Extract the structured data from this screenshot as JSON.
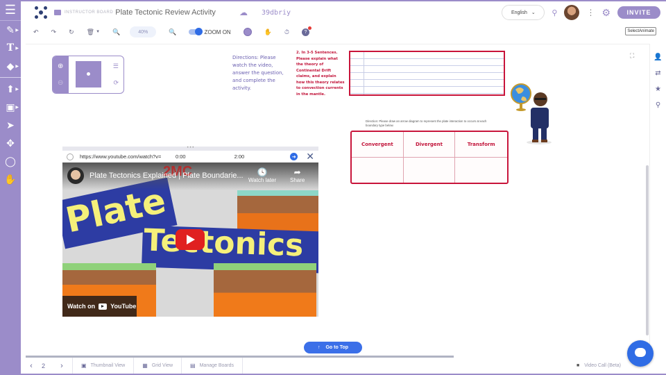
{
  "header": {
    "board_kind": "INSTRUCTOR BOARD",
    "board_title": "Plate Tectonic Review Activity",
    "board_code": "39dbriy",
    "language": "English",
    "invite_label": "INVITE"
  },
  "left_toolbar": {
    "items": [
      "menu",
      "pen",
      "text",
      "eraser",
      "upload",
      "toolbox",
      "pointer",
      "move",
      "lasso",
      "hand"
    ]
  },
  "toolbar": {
    "zoom_level": "40%",
    "zoom_toggle_label": "ZOOM ON",
    "select_animate_label": "SelectAnimate"
  },
  "canvas": {
    "directions": "Directions: Please watch the video, answer the question, and complete the activity.",
    "question": "2. In 3-5 Sentences. Please explain what the theory of Continental Drift claims, and explain how this theory relates to convection currents in the mantle.",
    "diagram_direction": "Direction: Please draw an arrow diagram to represent the plate interaction to occurs at each boundary type below.",
    "boundary_table": {
      "headers": [
        "Convergent",
        "Divergent",
        "Transform"
      ],
      "rows": [
        [
          "",
          "",
          ""
        ]
      ]
    }
  },
  "video": {
    "url": "https://www.youtube.com/watch?v=",
    "start_time": "0:00",
    "end_time": "2:00",
    "title": "Plate Tectonics Explained | Plate Boundarie...",
    "channel_logo_text": "2MC",
    "watch_later_label": "Watch later",
    "share_label": "Share",
    "thumbnail_word1": "Plate",
    "thumbnail_word2": "Tectonics",
    "watch_on_label": "Watch on",
    "youtube_label": "YouTube"
  },
  "go_to_top_label": "Go to Top",
  "bottom_bar": {
    "page_number": "2",
    "thumbnail_view_label": "Thumbnail View",
    "grid_view_label": "Grid View",
    "manage_boards_label": "Manage Boards",
    "video_call_label": "Video Call (Beta)"
  },
  "colors": {
    "brand_purple": "#9b8cc9",
    "accent_blue": "#2f6ce5",
    "worksheet_red": "#c8143a"
  }
}
